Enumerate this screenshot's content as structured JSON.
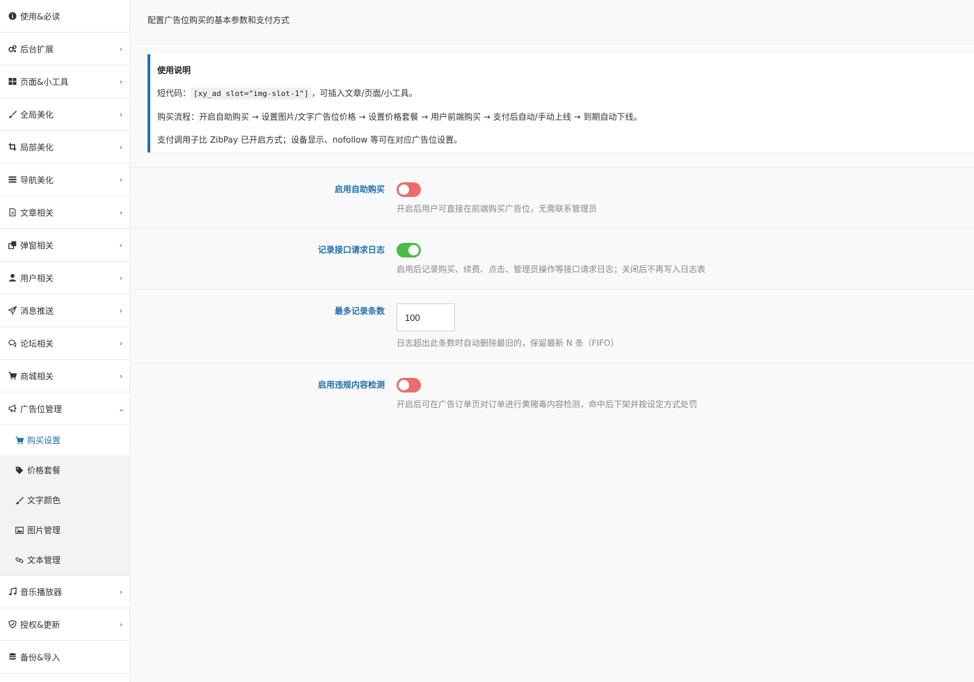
{
  "sidebar": {
    "items": [
      {
        "label": "使用&必读",
        "icon": "info-icon",
        "chevron": ""
      },
      {
        "label": "后台扩展",
        "icon": "gears-icon",
        "chevron": "›"
      },
      {
        "label": "页面&小工具",
        "icon": "grid-icon",
        "chevron": "›"
      },
      {
        "label": "全局美化",
        "icon": "brush-icon",
        "chevron": "›"
      },
      {
        "label": "局部美化",
        "icon": "crop-icon",
        "chevron": "›"
      },
      {
        "label": "导航美化",
        "icon": "list-icon",
        "chevron": "›"
      },
      {
        "label": "文章相关",
        "icon": "document-icon",
        "chevron": "›"
      },
      {
        "label": "弹窗相关",
        "icon": "window-icon",
        "chevron": "›"
      },
      {
        "label": "用户相关",
        "icon": "user-icon",
        "chevron": "›"
      },
      {
        "label": "消息推送",
        "icon": "paper-plane-icon",
        "chevron": "›"
      },
      {
        "label": "论坛相关",
        "icon": "comments-icon",
        "chevron": "›"
      },
      {
        "label": "商城相关",
        "icon": "cart-icon",
        "chevron": "›"
      },
      {
        "label": "广告位管理",
        "icon": "megaphone-icon",
        "chevron": "⌄"
      }
    ],
    "submenu": [
      {
        "label": "购买设置",
        "icon": "cart-icon",
        "active": true
      },
      {
        "label": "价格套餐",
        "icon": "tag-icon",
        "active": false
      },
      {
        "label": "文字颜色",
        "icon": "brush-icon",
        "active": false
      },
      {
        "label": "图片管理",
        "icon": "image-icon",
        "active": false
      },
      {
        "label": "文本管理",
        "icon": "link-icon",
        "active": false
      }
    ],
    "items_after": [
      {
        "label": "音乐播放器",
        "icon": "music-icon",
        "chevron": "›"
      },
      {
        "label": "授权&更新",
        "icon": "shield-icon",
        "chevron": "›"
      },
      {
        "label": "备份&导入",
        "icon": "database-icon",
        "chevron": ""
      }
    ]
  },
  "header": {
    "description": "配置广告位购买的基本参数和支付方式"
  },
  "notice": {
    "title": "使用说明",
    "shortcode_prefix": "短代码：",
    "shortcode": "[xy_ad slot=\"img-slot-1\"]",
    "shortcode_suffix": "，可插入文章/页面/小工具。",
    "flow": "购买流程：开启自助购买 → 设置图片/文字广告位价格 → 设置价格套餐 → 用户前端购买 → 支付后自动/手动上线 → 到期自动下线。",
    "payment": "支付调用子比 ZibPay 已开启方式；设备显示、nofollow 等可在对应广告位设置。"
  },
  "fields": [
    {
      "label": "启用自助购买",
      "type": "toggle",
      "value": false,
      "help": "开启后用户可直接在前端购买广告位，无需联系管理员"
    },
    {
      "label": "记录接口请求日志",
      "type": "toggle",
      "value": true,
      "help": "启用后记录购买、续费、点击、管理员操作等接口请求日志；关闭后不再写入日志表"
    },
    {
      "label": "最多记录条数",
      "type": "number",
      "value": "100",
      "help": "日志超出此条数时自动删除最旧的，保留最新 N 条（FIFO）"
    },
    {
      "label": "启用违规内容检测",
      "type": "toggle",
      "value": false,
      "help": "开启后可在广告订单页对订单进行黄赌毒内容检测，命中后下架并按设定方式处罚"
    }
  ],
  "colors": {
    "accent": "#2271b1",
    "toggle_off": "#ed6b6b",
    "toggle_on": "#4cba4c"
  }
}
